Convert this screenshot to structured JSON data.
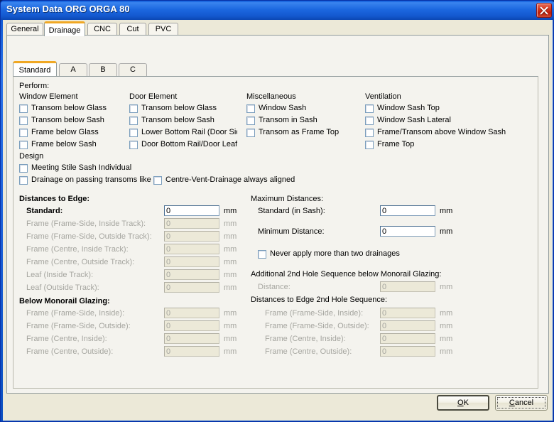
{
  "window": {
    "title": "System Data ORG ORGA  80",
    "close_icon": "close-icon"
  },
  "outer_tabs": [
    {
      "label": "General",
      "selected": false
    },
    {
      "label": "Drainage",
      "selected": true
    },
    {
      "label": "CNC",
      "selected": false
    },
    {
      "label": "Cut",
      "selected": false
    },
    {
      "label": "PVC",
      "selected": false
    }
  ],
  "inner_tabs": [
    {
      "label": "Standard",
      "selected": true
    },
    {
      "label": "A",
      "selected": false
    },
    {
      "label": "B",
      "selected": false
    },
    {
      "label": "C",
      "selected": false
    }
  ],
  "perform": {
    "heading": "Perform:",
    "columns": [
      {
        "heading": "Window Element",
        "items": [
          {
            "label": "Transom below Glass",
            "checked": false
          },
          {
            "label": "Transom below Sash",
            "checked": false
          },
          {
            "label": "Frame below Glass",
            "checked": false
          },
          {
            "label": "Frame below Sash",
            "checked": false
          }
        ]
      },
      {
        "heading": "Door Element",
        "items": [
          {
            "label": "Transom below Glass",
            "checked": false
          },
          {
            "label": "Transom below Sash",
            "checked": false
          },
          {
            "label": "Lower Bottom Rail (Door Side Light)",
            "checked": false
          },
          {
            "label": "Door Bottom Rail/Door Leaf",
            "checked": false
          }
        ]
      },
      {
        "heading": "Miscellaneous",
        "items": [
          {
            "label": "Window Sash",
            "checked": false
          },
          {
            "label": "Transom in Sash",
            "checked": false
          },
          {
            "label": "Transom as Frame Top",
            "checked": false
          }
        ]
      },
      {
        "heading": "Ventilation",
        "items": [
          {
            "label": "Window Sash Top",
            "checked": false
          },
          {
            "label": "Window Sash Lateral",
            "checked": false
          },
          {
            "label": "Frame/Transom above Window Sash",
            "checked": false
          },
          {
            "label": "Frame Top",
            "checked": false
          }
        ]
      }
    ]
  },
  "design": {
    "heading": "Design",
    "items": [
      {
        "label": "Meeting Stile Sash Individual",
        "checked": false
      },
      {
        "label": "Drainage on passing transoms like frame",
        "checked": false
      },
      {
        "label": "Centre-Vent-Drainage always aligned",
        "checked": false
      }
    ]
  },
  "distances_to_edge": {
    "heading": "Distances to Edge:",
    "rows": [
      {
        "label": "Standard:",
        "value": "0",
        "unit": "mm",
        "enabled": true,
        "bold": true
      },
      {
        "label": "Frame (Frame-Side, Inside Track):",
        "value": "0",
        "unit": "mm",
        "enabled": false
      },
      {
        "label": "Frame (Frame-Side, Outside Track):",
        "value": "0",
        "unit": "mm",
        "enabled": false
      },
      {
        "label": "Frame (Centre, Inside Track):",
        "value": "0",
        "unit": "mm",
        "enabled": false
      },
      {
        "label": "Frame (Centre, Outside Track):",
        "value": "0",
        "unit": "mm",
        "enabled": false
      },
      {
        "label": "Leaf (Inside Track):",
        "value": "0",
        "unit": "mm",
        "enabled": false
      },
      {
        "label": "Leaf (Outside Track):",
        "value": "0",
        "unit": "mm",
        "enabled": false
      }
    ]
  },
  "below_monorail_glazing": {
    "heading": "Below Monorail Glazing:",
    "rows": [
      {
        "label": "Frame (Frame-Side, Inside):",
        "value": "0",
        "unit": "mm",
        "enabled": false
      },
      {
        "label": "Frame (Frame-Side, Outside):",
        "value": "0",
        "unit": "mm",
        "enabled": false
      },
      {
        "label": "Frame (Centre, Inside):",
        "value": "0",
        "unit": "mm",
        "enabled": false
      },
      {
        "label": "Frame (Centre, Outside):",
        "value": "0",
        "unit": "mm",
        "enabled": false
      }
    ]
  },
  "maximum_distances": {
    "heading": "Maximum Distances:",
    "rows": [
      {
        "label": "Standard (in Sash):",
        "value": "0",
        "unit": "mm",
        "enabled": true
      },
      {
        "label": "Minimum Distance:",
        "value": "0",
        "unit": "mm",
        "enabled": true
      }
    ],
    "never_apply": {
      "label": "Never apply more than two drainages",
      "checked": false
    }
  },
  "additional_2nd_hole": {
    "heading": "Additional 2nd Hole Sequence below Monorail Glazing:",
    "rows": [
      {
        "label": "Distance:",
        "value": "0",
        "unit": "mm",
        "enabled": false
      }
    ]
  },
  "distances_2nd_hole": {
    "heading": "Distances to Edge 2nd Hole Sequence:",
    "rows": [
      {
        "label": "Frame (Frame-Side, Inside):",
        "value": "0",
        "unit": "mm",
        "enabled": false
      },
      {
        "label": "Frame (Frame-Side, Outside):",
        "value": "0",
        "unit": "mm",
        "enabled": false
      },
      {
        "label": "Frame (Centre, Inside):",
        "value": "0",
        "unit": "mm",
        "enabled": false
      },
      {
        "label": "Frame (Centre, Outside):",
        "value": "0",
        "unit": "mm",
        "enabled": false
      }
    ]
  },
  "buttons": {
    "ok": "OK",
    "ok_accel": "O",
    "cancel": "Cancel",
    "cancel_accel": "C"
  },
  "colors": {
    "titlebar_blue": "#1c68e0",
    "close_red": "#c52f18",
    "tab_accent_orange": "#f0a824",
    "dialog_beige": "#ece9d8",
    "page_bg": "#f4f3ee",
    "disabled_text": "#a6a6a0"
  }
}
